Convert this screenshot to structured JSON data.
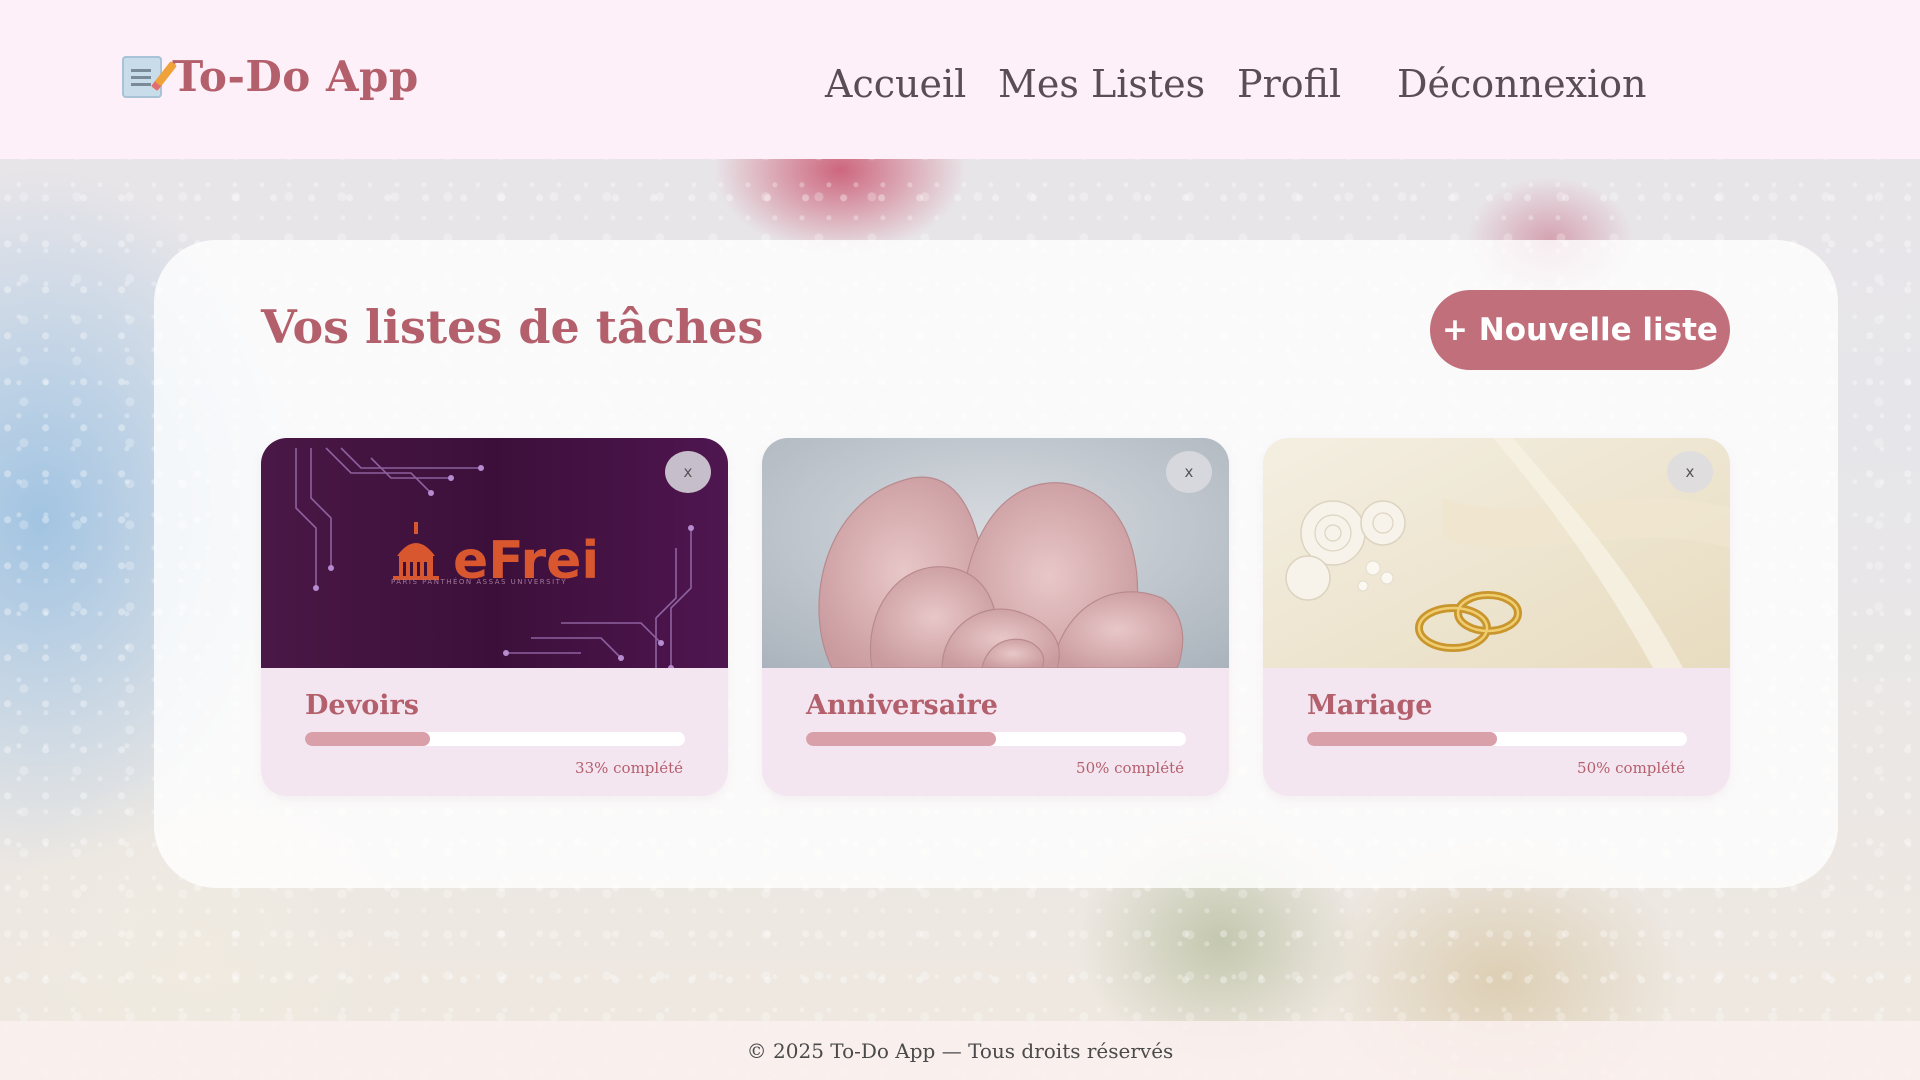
{
  "app": {
    "title": "To-Do App"
  },
  "nav": {
    "items": [
      {
        "label": "Accueil"
      },
      {
        "label": "Mes Listes"
      },
      {
        "label": "Profil"
      },
      {
        "label": "Déconnexion"
      }
    ]
  },
  "main": {
    "title": "Vos listes de tâches",
    "new_list_label": "+ Nouvelle liste",
    "lists": [
      {
        "name": "Devoirs",
        "progress": 0.33,
        "progress_label": "33% complété",
        "image": "efrei-banner",
        "image_logo_text": "eFrei",
        "image_logo_subtitle": "PARIS PANTHÉON ASSAS UNIVERSITY",
        "delete_label": "x"
      },
      {
        "name": "Anniversaire",
        "progress": 0.5,
        "progress_label": "50% complété",
        "image": "pink-petal-abstract",
        "delete_label": "x"
      },
      {
        "name": "Mariage",
        "progress": 0.5,
        "progress_label": "50% complété",
        "image": "wedding-rings",
        "delete_label": "x"
      }
    ]
  },
  "footer": {
    "text": "© 2025 To-Do App — Tous droits réservés"
  },
  "colors": {
    "accent": "#b4606c",
    "button": "#c16f7b",
    "header_bg": "#fdf0f8",
    "card_bg": "#f4e6f1",
    "progress_fill": "#d9a0aa"
  },
  "icons": {
    "logo": "memo-icon",
    "delete": "close-icon"
  }
}
